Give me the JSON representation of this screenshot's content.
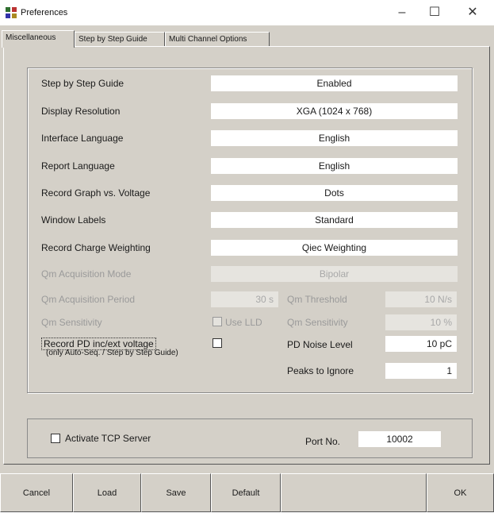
{
  "window": {
    "title": "Preferences",
    "minimize": "–",
    "maximize": "☐",
    "close": "✕"
  },
  "tabs": [
    "Miscellaneous",
    "Step by Step Guide",
    "Multi Channel Options"
  ],
  "settings": [
    {
      "label": "Step by Step Guide",
      "value": "Enabled"
    },
    {
      "label": "Display Resolution",
      "value": "XGA (1024 x 768)"
    },
    {
      "label": "Interface Language",
      "value": "English"
    },
    {
      "label": "Report Language",
      "value": "English"
    },
    {
      "label": "Record Graph vs. Voltage",
      "value": "Dots"
    },
    {
      "label": "Window Labels",
      "value": "Standard"
    },
    {
      "label": "Record Charge Weighting",
      "value": "Qiec Weighting"
    },
    {
      "label": "Qm Acquisition Mode",
      "value": "Bipolar"
    }
  ],
  "qm": {
    "period_label": "Qm Acquisition Period",
    "period_value": "30 s",
    "threshold_label": "Qm Threshold",
    "threshold_value": "10 N/s",
    "sensitivity_label": "Qm Sensitivity",
    "use_lld_label": "Use LLD",
    "sensitivity2_label": "Qm Sensitivity",
    "sensitivity2_value": "10 %"
  },
  "pd": {
    "record_label": "Record PD inc/ext voltage",
    "record_note": "(only Auto-Seq. / Step by Step Guide)",
    "noise_label": "PD Noise Level",
    "noise_value": "10 pC",
    "peaks_label": "Peaks to Ignore",
    "peaks_value": "1"
  },
  "tcp": {
    "activate_label": "Activate TCP Server",
    "port_label": "Port No.",
    "port_value": "10002"
  },
  "buttons": {
    "cancel": "Cancel",
    "load": "Load",
    "save": "Save",
    "default": "Default",
    "ok": "OK"
  }
}
